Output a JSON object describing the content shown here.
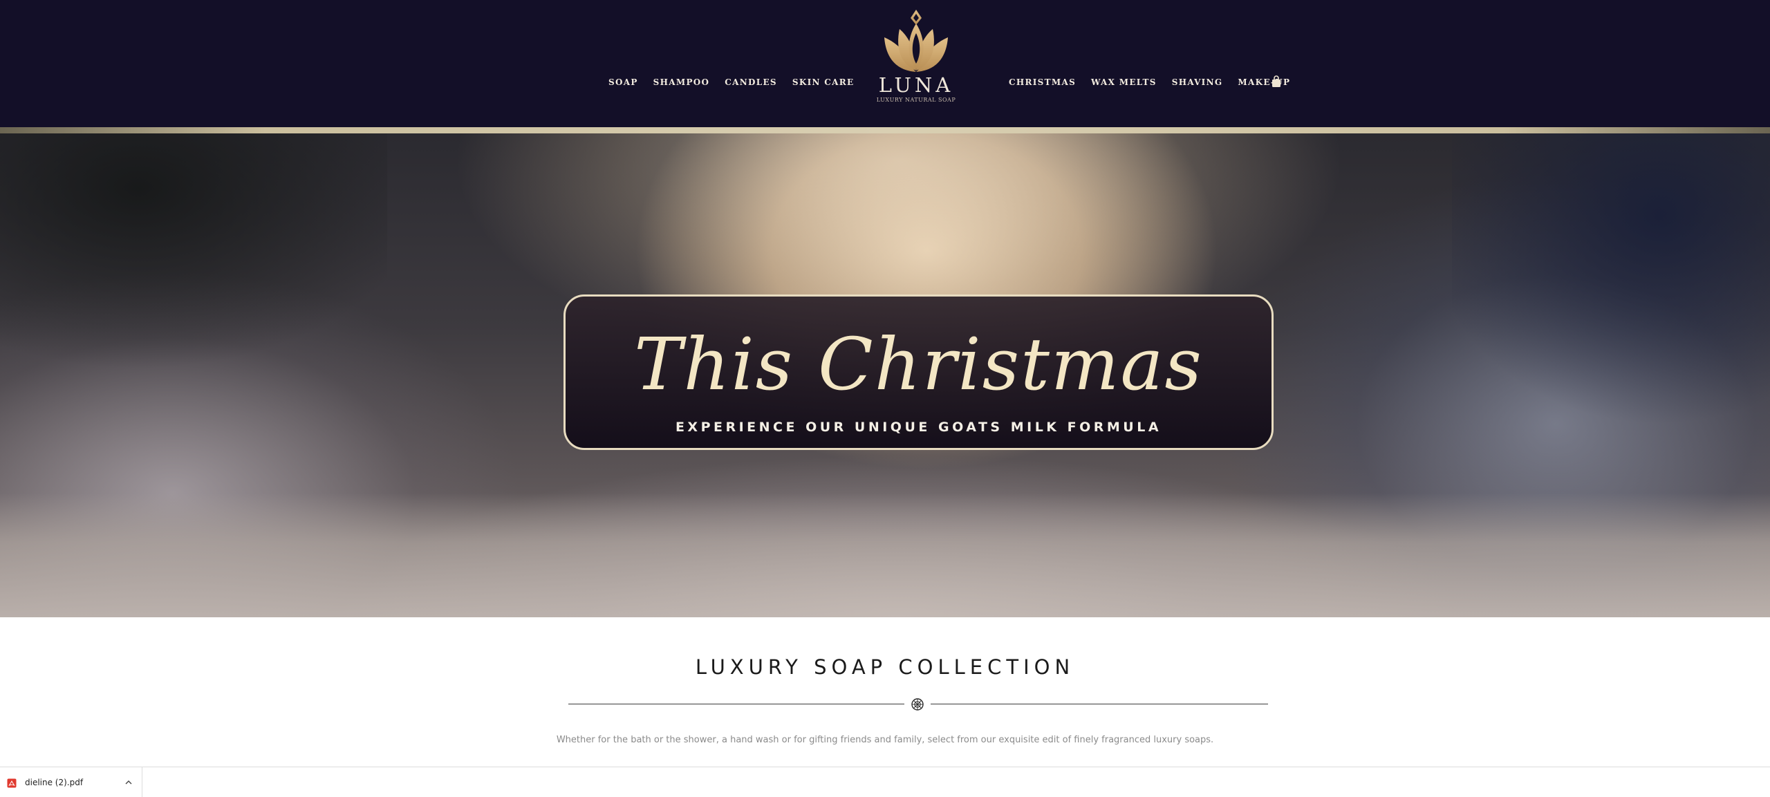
{
  "nav": {
    "left": [
      "SOAP",
      "SHAMPOO",
      "CANDLES",
      "SKIN CARE"
    ],
    "right": [
      "CHRISTMAS",
      "WAX MELTS",
      "SHAVING",
      "MAKE-UP"
    ],
    "cart_icon": "shopping-bag-icon"
  },
  "logo": {
    "name": "LUNA",
    "tagline": "LUXURY NATURAL SOAP",
    "icon": "lotus-icon"
  },
  "hero": {
    "title": "This Christmas",
    "subtitle": "EXPERIENCE OUR UNIQUE GOATS MILK FORMULA"
  },
  "collection": {
    "title": "LUXURY SOAP COLLECTION",
    "ornament_icon": "ornament-icon",
    "description": "Whether for the bath or the shower, a hand wash or for gifting friends and family, select from our exquisite edit of finely fragranced luxury soaps."
  },
  "download_bar": {
    "file_name": "dieline (2).pdf",
    "file_icon": "pdf-icon",
    "menu_icon": "chevron-up-icon"
  },
  "colors": {
    "header_bg": "#130f28",
    "gold": "#c9a46a",
    "cream": "#f3e6c4"
  }
}
